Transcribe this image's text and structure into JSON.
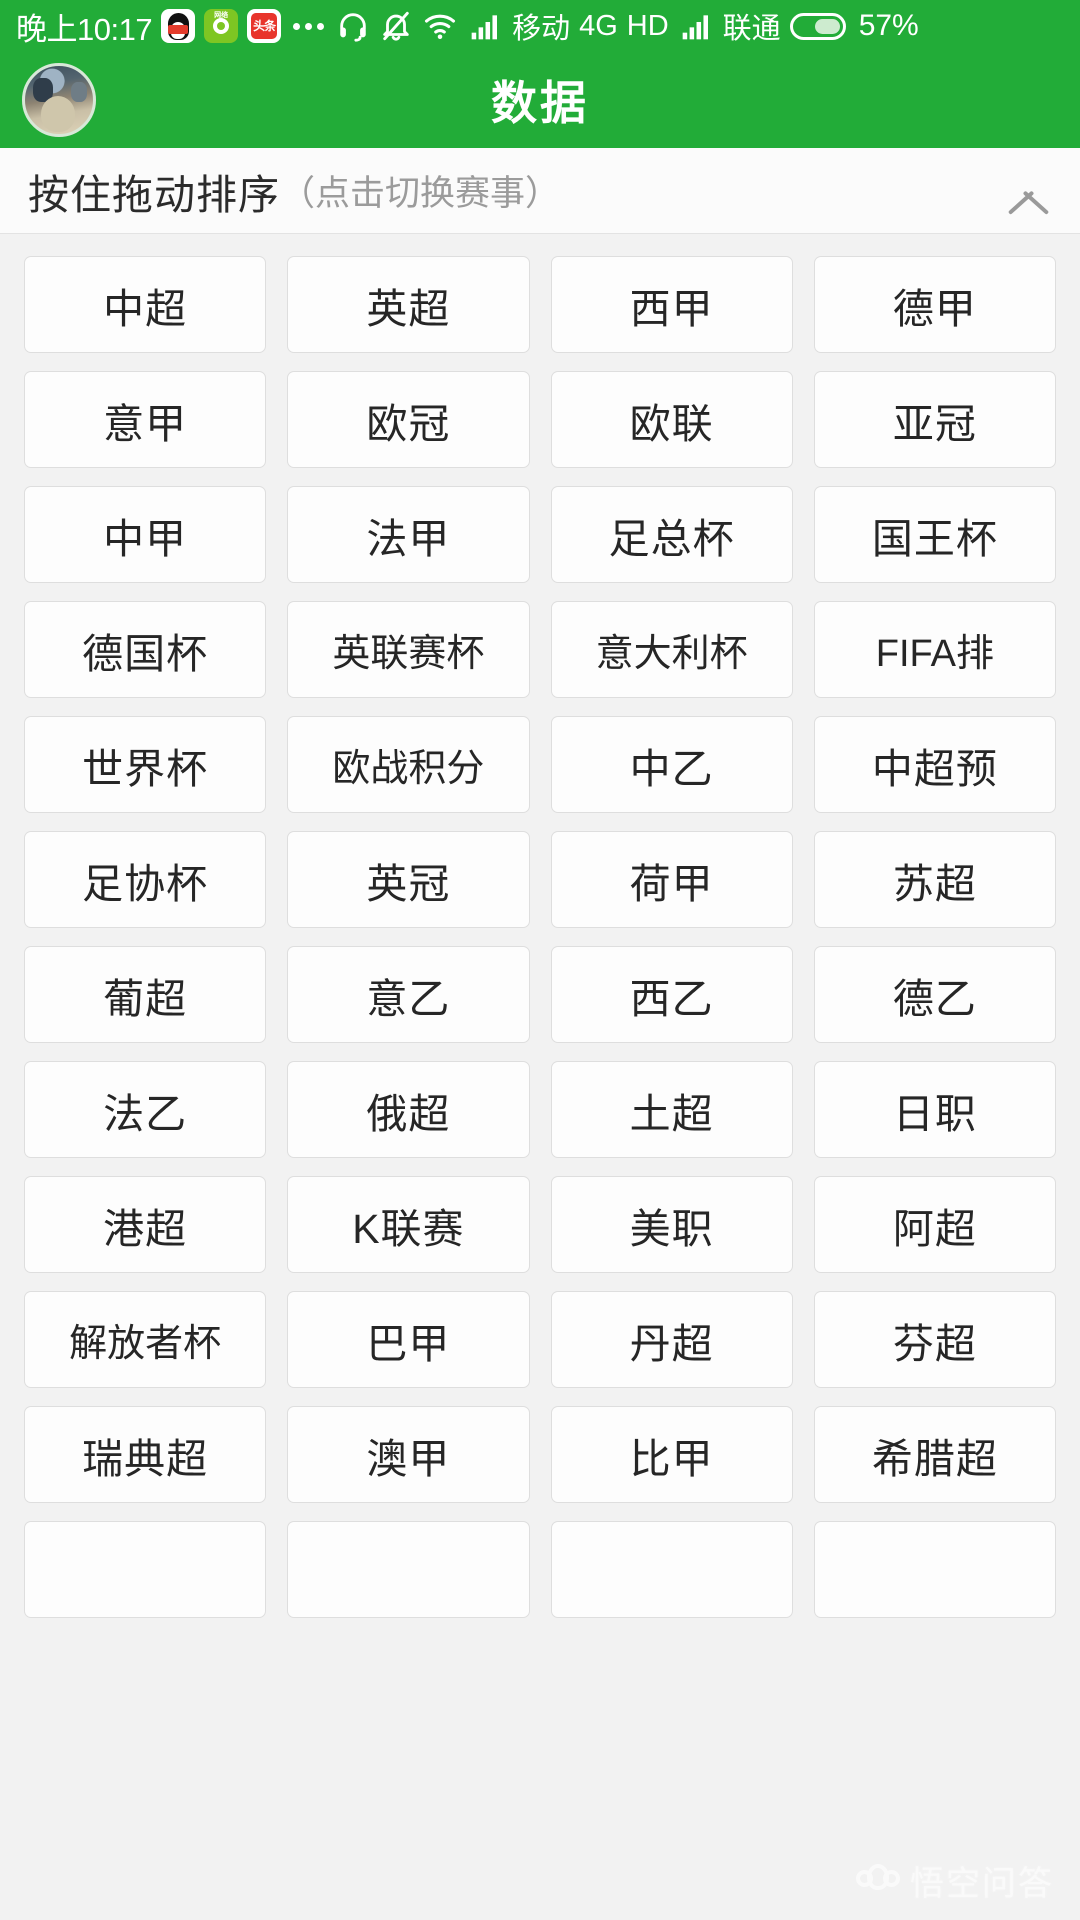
{
  "status_bar": {
    "time": "晚上10:17",
    "app_icons": [
      "qq-icon",
      "green-app-icon",
      "toutiao-icon"
    ],
    "overflow_dots": "•••",
    "icons": [
      "headset-icon",
      "bell-muted-icon",
      "wifi-icon",
      "signal-bars-icon"
    ],
    "carrier_primary": "移动",
    "network_type": "4G",
    "hd_label": "HD",
    "carrier_secondary": "联通",
    "battery_percent": "57%",
    "battery_level": 57,
    "background_color": "#22ac38"
  },
  "header": {
    "title": "数据",
    "avatar": "user-avatar",
    "background_color": "#22ac38"
  },
  "sort_header": {
    "main_label": "按住拖动排序",
    "sub_label": "（点击切换赛事）",
    "collapse_icon": "chevron-up-icon"
  },
  "grid": {
    "columns": 4,
    "tiles": [
      "中超",
      "英超",
      "西甲",
      "德甲",
      "意甲",
      "欧冠",
      "欧联",
      "亚冠",
      "中甲",
      "法甲",
      "足总杯",
      "国王杯",
      "德国杯",
      "英联赛杯",
      "意大利杯",
      "FIFA排",
      "世界杯",
      "欧战积分",
      "中乙",
      "中超预",
      "足协杯",
      "英冠",
      "荷甲",
      "苏超",
      "葡超",
      "意乙",
      "西乙",
      "德乙",
      "法乙",
      "俄超",
      "土超",
      "日职",
      "港超",
      "K联赛",
      "美职",
      "阿超",
      "解放者杯",
      "巴甲",
      "丹超",
      "芬超",
      "瑞典超",
      "澳甲",
      "比甲",
      "希腊超",
      "",
      "",
      "",
      ""
    ]
  },
  "watermark": {
    "text": "悟空问答",
    "logo": "wukong-monkey-icon"
  }
}
